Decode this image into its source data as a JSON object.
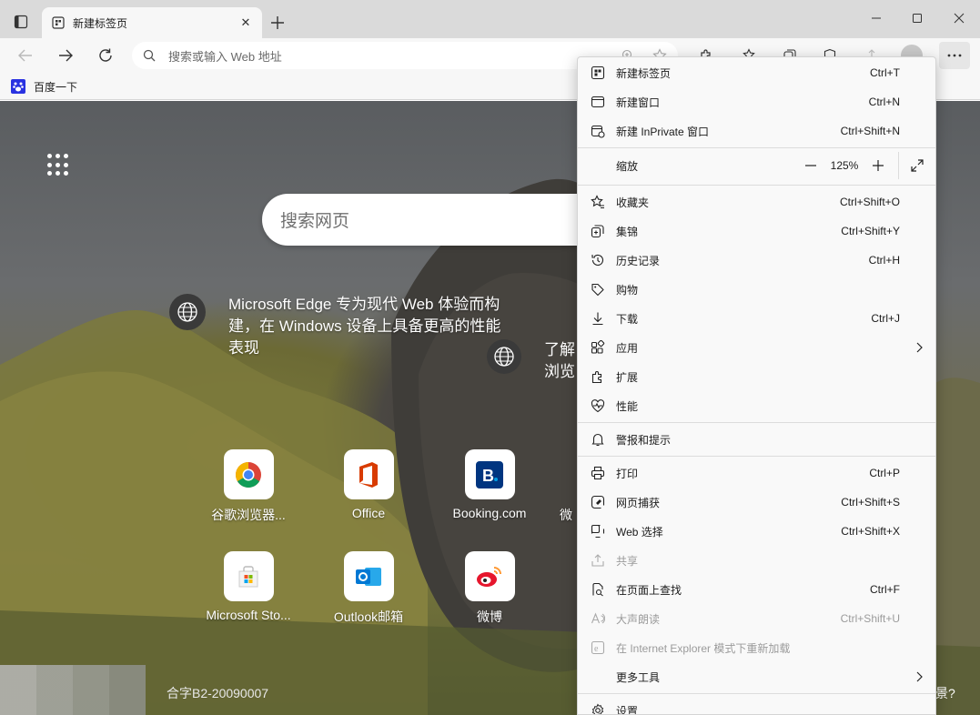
{
  "browser": {
    "tab_title": "新建标签页",
    "address_placeholder": "搜索或输入 Web 地址"
  },
  "favorites": [
    {
      "label": "百度一下"
    }
  ],
  "newtab": {
    "search_placeholder": "搜索网页",
    "news_text": "Microsoft Edge 专为现代 Web 体验而构建，在 Windows 设备上具备更高的性能表现",
    "news_text_2_line1": "了解",
    "news_text_2_line2": "浏览",
    "quick_links": [
      {
        "label": "谷歌浏览器..."
      },
      {
        "label": "Office"
      },
      {
        "label": "Booking.com"
      },
      {
        "label": "微"
      },
      {
        "label": "Microsoft Sto..."
      },
      {
        "label": "Outlook邮箱"
      },
      {
        "label": "微博"
      }
    ],
    "footer_license": "合字B2-20090007",
    "footer_right": "景?"
  },
  "menu": {
    "items": [
      {
        "label": "新建标签页",
        "shortcut": "Ctrl+T",
        "icon": "new-tab-icon"
      },
      {
        "label": "新建窗口",
        "shortcut": "Ctrl+N",
        "icon": "new-window-icon"
      },
      {
        "label": "新建 InPrivate 窗口",
        "shortcut": "Ctrl+Shift+N",
        "icon": "inprivate-icon"
      },
      {
        "label": "收藏夹",
        "shortcut": "Ctrl+Shift+O",
        "icon": "favorites-icon"
      },
      {
        "label": "集锦",
        "shortcut": "Ctrl+Shift+Y",
        "icon": "collections-icon"
      },
      {
        "label": "历史记录",
        "shortcut": "Ctrl+H",
        "icon": "history-icon"
      },
      {
        "label": "购物",
        "shortcut": "",
        "icon": "shopping-tag-icon"
      },
      {
        "label": "下载",
        "shortcut": "Ctrl+J",
        "icon": "download-icon"
      },
      {
        "label": "应用",
        "shortcut": "",
        "icon": "apps-icon"
      },
      {
        "label": "扩展",
        "shortcut": "",
        "icon": "extensions-icon"
      },
      {
        "label": "性能",
        "shortcut": "",
        "icon": "performance-icon"
      },
      {
        "label": "警报和提示",
        "shortcut": "",
        "icon": "bell-icon"
      },
      {
        "label": "打印",
        "shortcut": "Ctrl+P",
        "icon": "print-icon"
      },
      {
        "label": "网页捕获",
        "shortcut": "Ctrl+Shift+S",
        "icon": "web-capture-icon"
      },
      {
        "label": "Web 选择",
        "shortcut": "Ctrl+Shift+X",
        "icon": "web-select-icon"
      },
      {
        "label": "共享",
        "shortcut": "",
        "icon": "share-icon"
      },
      {
        "label": "在页面上查找",
        "shortcut": "Ctrl+F",
        "icon": "find-icon"
      },
      {
        "label": "大声朗读",
        "shortcut": "Ctrl+Shift+U",
        "icon": "read-aloud-icon"
      },
      {
        "label": "在 Internet Explorer 模式下重新加载",
        "shortcut": "",
        "icon": "ie-mode-icon"
      },
      {
        "label": "更多工具",
        "shortcut": "",
        "icon": "more-tools-icon"
      },
      {
        "label": "设置",
        "shortcut": "",
        "icon": "settings-icon"
      }
    ],
    "zoom_label": "缩放",
    "zoom_value": "125%"
  }
}
